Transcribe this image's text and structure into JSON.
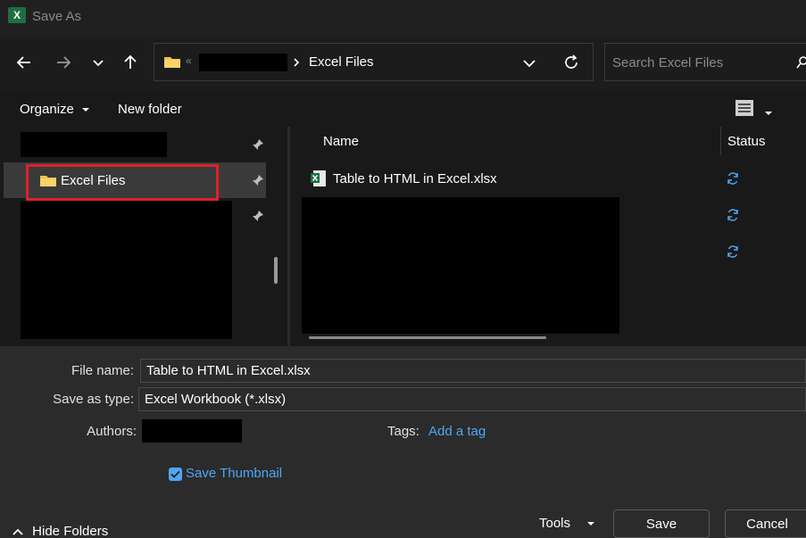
{
  "window": {
    "title": "Save As",
    "app_icon_letter": "X"
  },
  "address": {
    "crumb_separator": "«",
    "current_folder": "Excel Files"
  },
  "search": {
    "placeholder": "Search Excel Files"
  },
  "toolbar": {
    "organize_label": "Organize",
    "new_folder_label": "New folder"
  },
  "nav": {
    "items": [
      {
        "label": ""
      },
      {
        "label": "Excel Files"
      },
      {
        "label": ""
      }
    ]
  },
  "files": {
    "columns": {
      "name": "Name",
      "status": "Status"
    },
    "rows": [
      {
        "name": "Table to HTML in Excel.xlsx"
      }
    ]
  },
  "form": {
    "file_name_label": "File name:",
    "file_name_value": "Table to HTML in Excel.xlsx",
    "type_label": "Save as type:",
    "type_value": "Excel Workbook (*.xlsx)",
    "authors_label": "Authors:",
    "tags_label": "Tags:",
    "tags_link": "Add a tag",
    "thumbnail_label": "Save Thumbnail"
  },
  "footer": {
    "hide_folders_label": "Hide Folders",
    "tools_label": "Tools",
    "save_label": "Save",
    "cancel_label": "Cancel"
  },
  "colors": {
    "accent": "#4ea6f5",
    "highlight_border": "#e0202a",
    "folder": "#f2c14e",
    "excel_green": "#1d6f42"
  }
}
